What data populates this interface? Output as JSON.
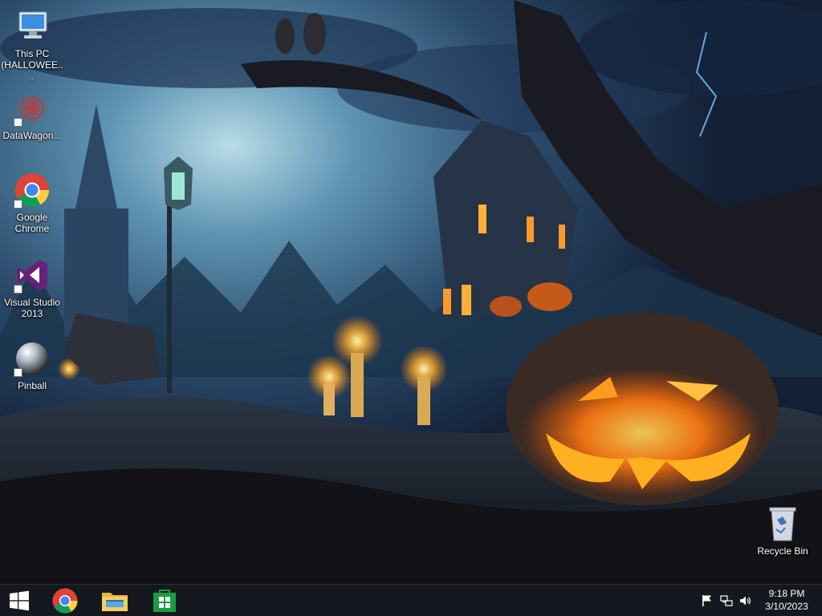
{
  "desktop": {
    "icons": [
      {
        "label": "This PC\n(HALLOWEE...",
        "icon": "computer-icon"
      },
      {
        "label": "DataWagon...",
        "icon": "datawagon-icon"
      },
      {
        "label": "Google\nChrome",
        "icon": "chrome-icon"
      },
      {
        "label": "Visual Studio\n2013",
        "icon": "visual-studio-icon"
      },
      {
        "label": "Pinball",
        "icon": "pinball-icon"
      },
      {
        "label": "Recycle Bin",
        "icon": "recycle-bin-icon"
      }
    ]
  },
  "taskbar": {
    "start": {
      "icon": "windows-logo-icon"
    },
    "pinned": [
      {
        "icon": "chrome-icon"
      },
      {
        "icon": "file-explorer-icon"
      },
      {
        "icon": "store-icon"
      }
    ],
    "tray": [
      {
        "icon": "action-center-flag-icon"
      },
      {
        "icon": "network-icon"
      },
      {
        "icon": "volume-icon"
      }
    ],
    "clock": {
      "time": "9:18 PM",
      "date": "3/10/2023"
    }
  },
  "colors": {
    "taskbar": "#16181e",
    "accent_orange": "#ff8a1c",
    "sky": "#3a6a8e"
  }
}
